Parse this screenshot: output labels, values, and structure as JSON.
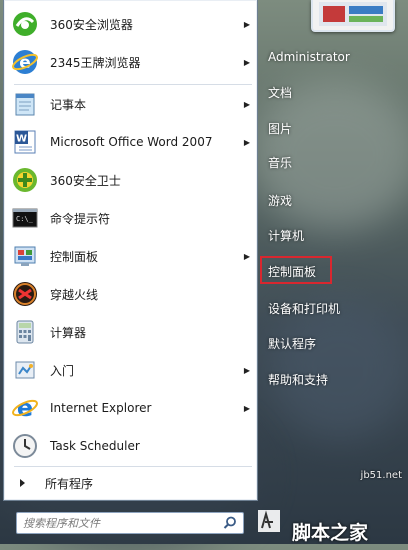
{
  "programs": [
    {
      "label": "360安全浏览器",
      "icon": "360-browser-icon",
      "submenu": true
    },
    {
      "label": "2345王牌浏览器",
      "icon": "2345-browser-icon",
      "submenu": true
    },
    {
      "label": "记事本",
      "icon": "notepad-icon",
      "submenu": true
    },
    {
      "label": "Microsoft Office Word 2007",
      "icon": "word-icon",
      "submenu": true
    },
    {
      "label": "360安全卫士",
      "icon": "360-safe-icon",
      "submenu": false
    },
    {
      "label": "命令提示符",
      "icon": "cmd-icon",
      "submenu": false
    },
    {
      "label": "控制面板",
      "icon": "control-panel-icon",
      "submenu": true
    },
    {
      "label": "穿越火线",
      "icon": "crossfire-icon",
      "submenu": false
    },
    {
      "label": "计算器",
      "icon": "calculator-icon",
      "submenu": false
    },
    {
      "label": "入门",
      "icon": "getting-started-icon",
      "submenu": true
    },
    {
      "label": "Internet Explorer",
      "icon": "ie-icon",
      "submenu": true
    },
    {
      "label": "Task Scheduler",
      "icon": "clock-icon",
      "submenu": false
    }
  ],
  "all_programs_label": "所有程序",
  "search": {
    "placeholder": "搜索程序和文件"
  },
  "right": {
    "user": "Administrator",
    "documents": "文档",
    "pictures": "图片",
    "music": "音乐",
    "games": "游戏",
    "computer": "计算机",
    "control_panel": "控制面板",
    "devices_printers": "设备和打印机",
    "default_programs": "默认程序",
    "help": "帮助和支持"
  },
  "watermark": {
    "site": "jb51.net",
    "brand": "脚本之家"
  },
  "colors": {
    "highlight": "#d9272f",
    "panel_border": "#6d7f91",
    "search_border": "#8ea4bf"
  }
}
